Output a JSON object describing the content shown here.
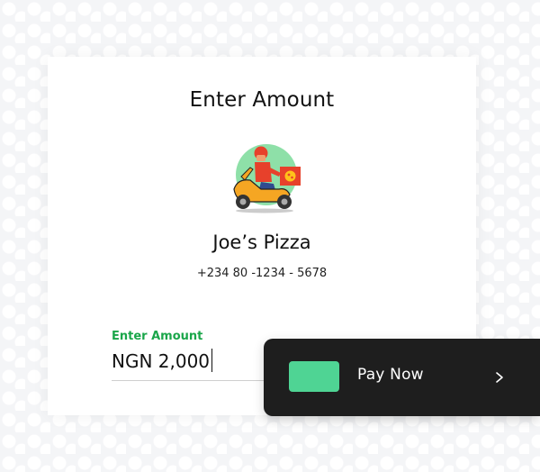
{
  "card": {
    "title": "Enter Amount",
    "merchant_name": "Joe’s Pizza",
    "merchant_phone": "+234 80 -1234 - 5678",
    "avatar_icon": "delivery-scooter-icon"
  },
  "amount_input": {
    "label": "Enter Amount",
    "value": "NGN 2,000"
  },
  "pay_button": {
    "label": "Pay Now",
    "chip_color": "#4fd494",
    "chevron_icon": "chevron-right-icon"
  },
  "colors": {
    "label_green": "#1aa64a",
    "pay_bar_background": "#1e1e1e"
  }
}
